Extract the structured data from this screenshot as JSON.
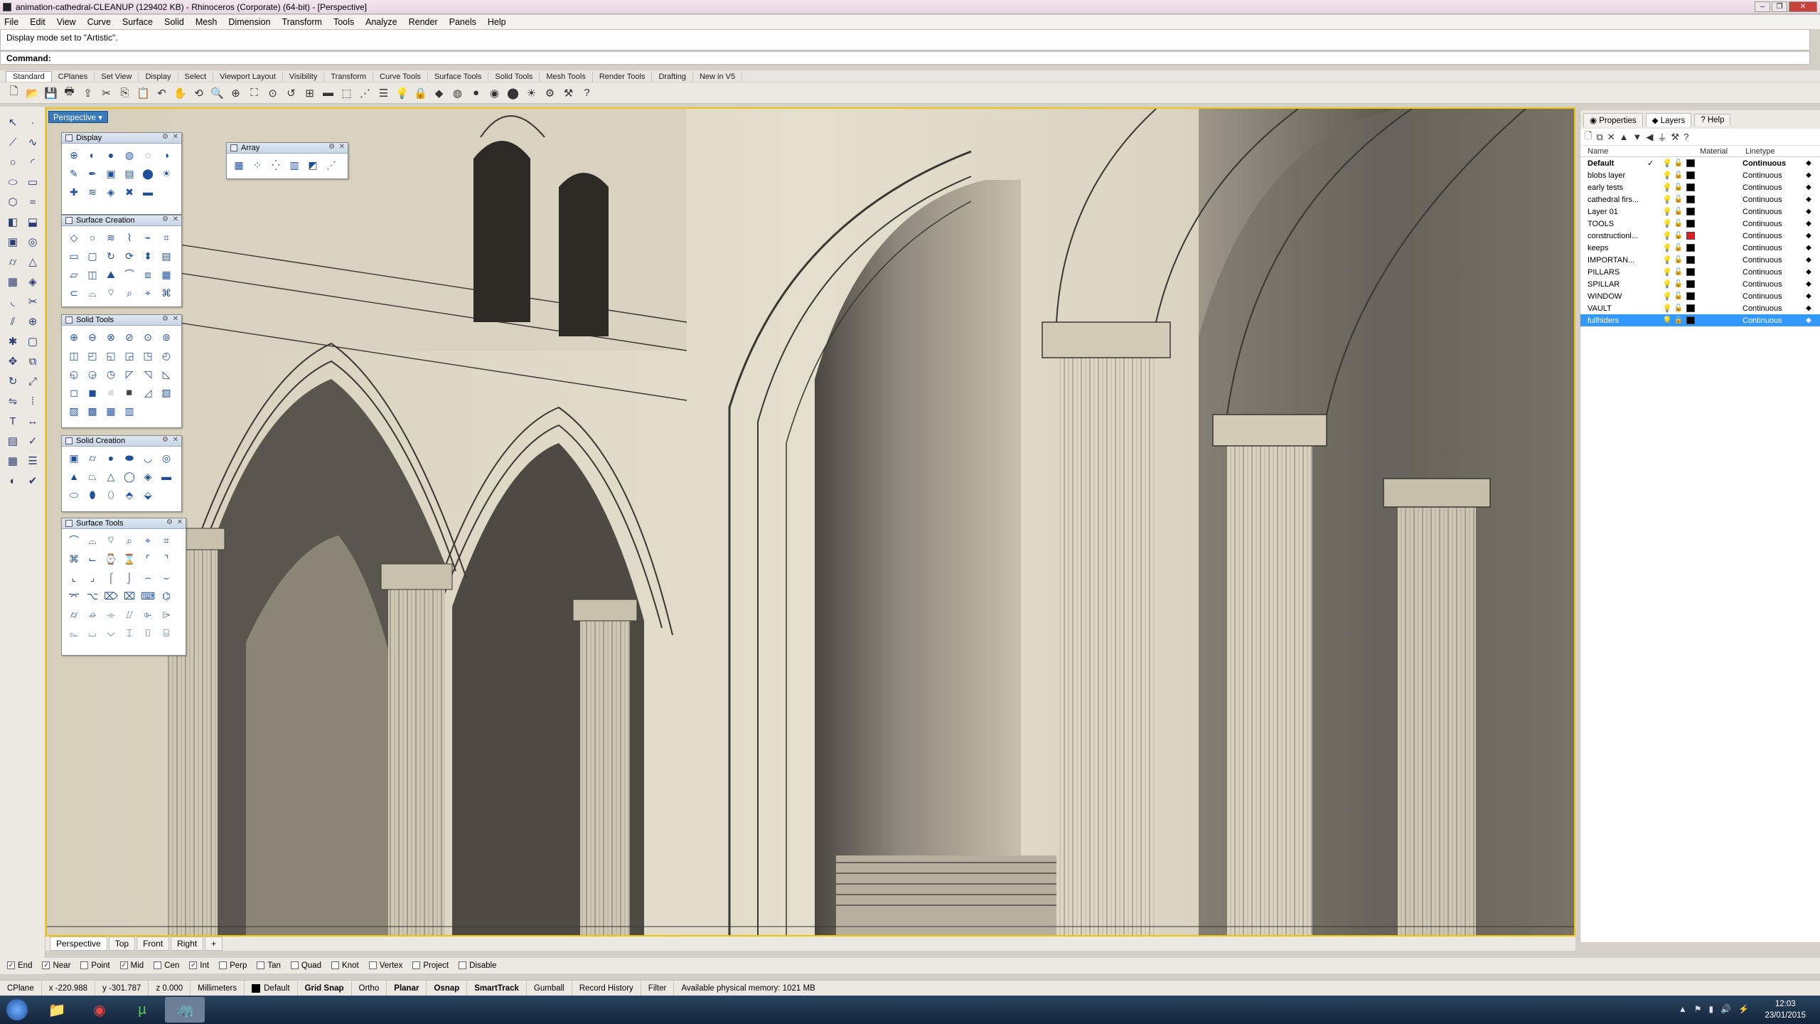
{
  "window": {
    "title": "animation-cathedral-CLEANUP (129402 KB) - Rhinoceros (Corporate) (64-bit) - [Perspective]",
    "controls": [
      "–",
      "❐",
      "✕"
    ]
  },
  "menu": [
    "File",
    "Edit",
    "View",
    "Curve",
    "Surface",
    "Solid",
    "Mesh",
    "Dimension",
    "Transform",
    "Tools",
    "Analyze",
    "Render",
    "Panels",
    "Help"
  ],
  "command": {
    "history": "Display mode set to \"Artistic\".",
    "prompt": "Command:",
    "value": ""
  },
  "toolbar_tabs": [
    "Standard",
    "CPlanes",
    "Set View",
    "Display",
    "Select",
    "Viewport Layout",
    "Visibility",
    "Transform",
    "Curve Tools",
    "Surface Tools",
    "Solid Tools",
    "Mesh Tools",
    "Render Tools",
    "Drafting",
    "New in V5"
  ],
  "viewport": {
    "label": "Perspective",
    "display_mode": "Artistic",
    "colors": {
      "background": "#e0d9c8",
      "line": "#3a3630",
      "accent": "#f0c400"
    }
  },
  "palettes": {
    "display": "Display",
    "array": "Array",
    "surface_creation": "Surface Creation",
    "solid_tools": "Solid Tools",
    "solid_creation": "Solid Creation",
    "surface_tools": "Surface Tools"
  },
  "panel": {
    "tabs": [
      "Properties",
      "Layers",
      "Help"
    ],
    "active_tab": "Layers",
    "columns": {
      "name": "Name",
      "material": "Material",
      "linetype": "Linetype"
    },
    "layers": [
      {
        "name": "Default",
        "current": "✓",
        "color": "#000000",
        "linetype": "Continuous"
      },
      {
        "name": "blobs layer",
        "current": "",
        "color": "#000000",
        "linetype": "Continuous"
      },
      {
        "name": "early tests",
        "current": "",
        "color": "#000000",
        "linetype": "Continuous"
      },
      {
        "name": "cathedral firs...",
        "current": "",
        "color": "#000000",
        "linetype": "Continuous"
      },
      {
        "name": "Layer 01",
        "current": "",
        "color": "#000000",
        "linetype": "Continuous"
      },
      {
        "name": "TOOLS",
        "current": "",
        "color": "#000000",
        "linetype": "Continuous"
      },
      {
        "name": "constructionl...",
        "current": "",
        "color": "#e02020",
        "linetype": "Continuous"
      },
      {
        "name": "keeps",
        "current": "",
        "color": "#000000",
        "linetype": "Continuous"
      },
      {
        "name": "IMPORTAN...",
        "current": "",
        "color": "#000000",
        "linetype": "Continuous"
      },
      {
        "name": "PILLARS",
        "current": "",
        "color": "#000000",
        "linetype": "Continuous"
      },
      {
        "name": "SPILLAR",
        "current": "",
        "color": "#000000",
        "linetype": "Continuous"
      },
      {
        "name": "WINDOW",
        "current": "",
        "color": "#000000",
        "linetype": "Continuous"
      },
      {
        "name": "VAULT",
        "current": "",
        "color": "#000000",
        "linetype": "Continuous"
      },
      {
        "name": "fullhiders",
        "current": "",
        "color": "#000000",
        "linetype": "Continuous"
      }
    ]
  },
  "view_tabs": [
    "Perspective",
    "Top",
    "Front",
    "Right"
  ],
  "view_tab_add": "+",
  "osnaps": [
    {
      "label": "End",
      "checked": true
    },
    {
      "label": "Near",
      "checked": true
    },
    {
      "label": "Point",
      "checked": false
    },
    {
      "label": "Mid",
      "checked": true
    },
    {
      "label": "Cen",
      "checked": false
    },
    {
      "label": "Int",
      "checked": true
    },
    {
      "label": "Perp",
      "checked": false
    },
    {
      "label": "Tan",
      "checked": false
    },
    {
      "label": "Quad",
      "checked": false
    },
    {
      "label": "Knot",
      "checked": false
    },
    {
      "label": "Vertex",
      "checked": false
    },
    {
      "label": "Project",
      "checked": false
    },
    {
      "label": "Disable",
      "checked": false
    }
  ],
  "status": {
    "cplane": "CPlane",
    "x": "x -220.988",
    "y": "y -301.787",
    "z": "z 0.000",
    "units": "Millimeters",
    "layer": "Default",
    "grid_snap": "Grid Snap",
    "ortho": "Ortho",
    "planar": "Planar",
    "osnap": "Osnap",
    "smarttrack": "SmartTrack",
    "gumball": "Gumball",
    "record_history": "Record History",
    "filter": "Filter",
    "memory": "Available physical memory: 1021 MB"
  },
  "taskbar": {
    "time": "12:03",
    "date": "23/01/2015"
  }
}
